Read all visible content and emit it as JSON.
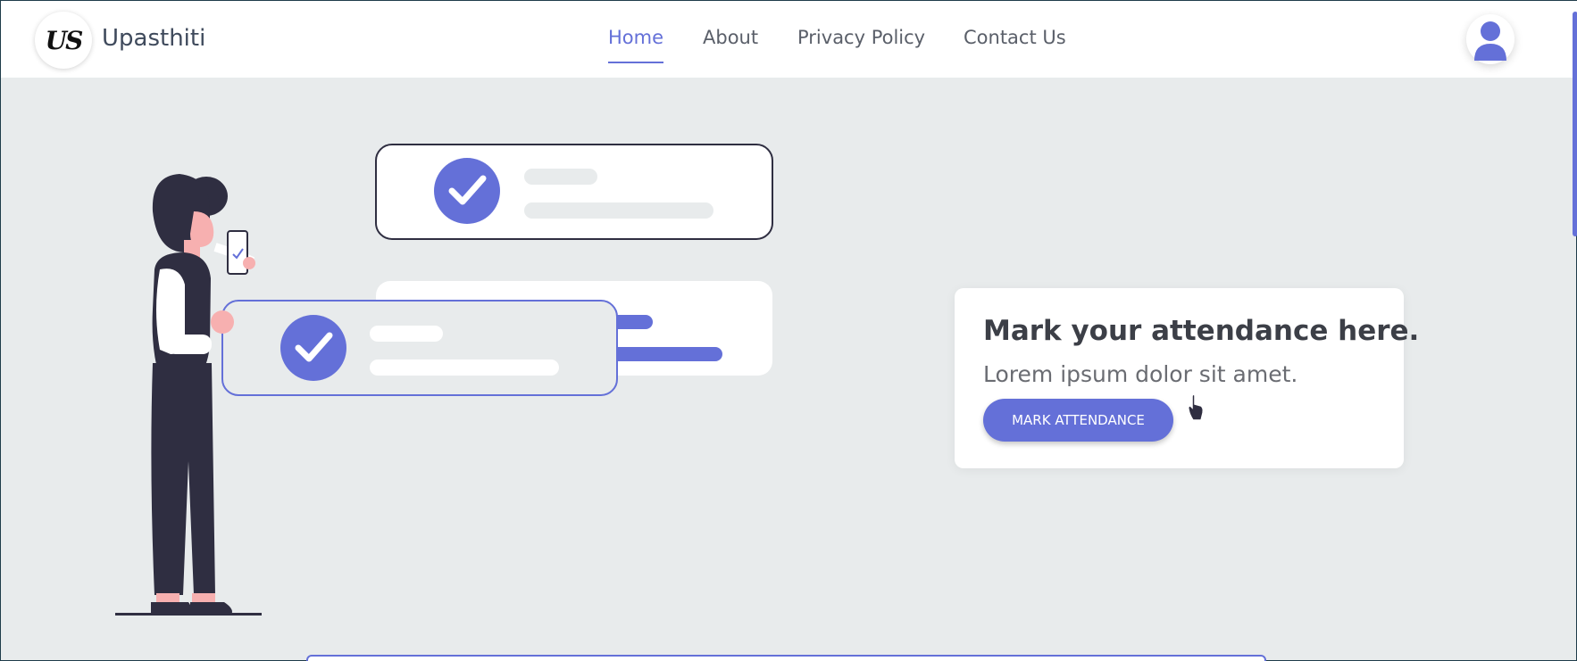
{
  "brand": {
    "logo_text": "US",
    "name": "Upasthiti"
  },
  "nav": {
    "items": [
      {
        "label": "Home",
        "active": true
      },
      {
        "label": "About",
        "active": false
      },
      {
        "label": "Privacy Policy",
        "active": false
      },
      {
        "label": "Contact Us",
        "active": false
      }
    ]
  },
  "user_menu": {
    "icon": "user-avatar-icon"
  },
  "hero_card": {
    "title": "Mark your attendance here.",
    "subtitle": "Lorem ipsum dolor sit amet.",
    "button_label": "MARK ATTENDANCE"
  },
  "colors": {
    "accent": "#6470d8",
    "background": "#e8ebec",
    "dark": "#2f2e41"
  }
}
